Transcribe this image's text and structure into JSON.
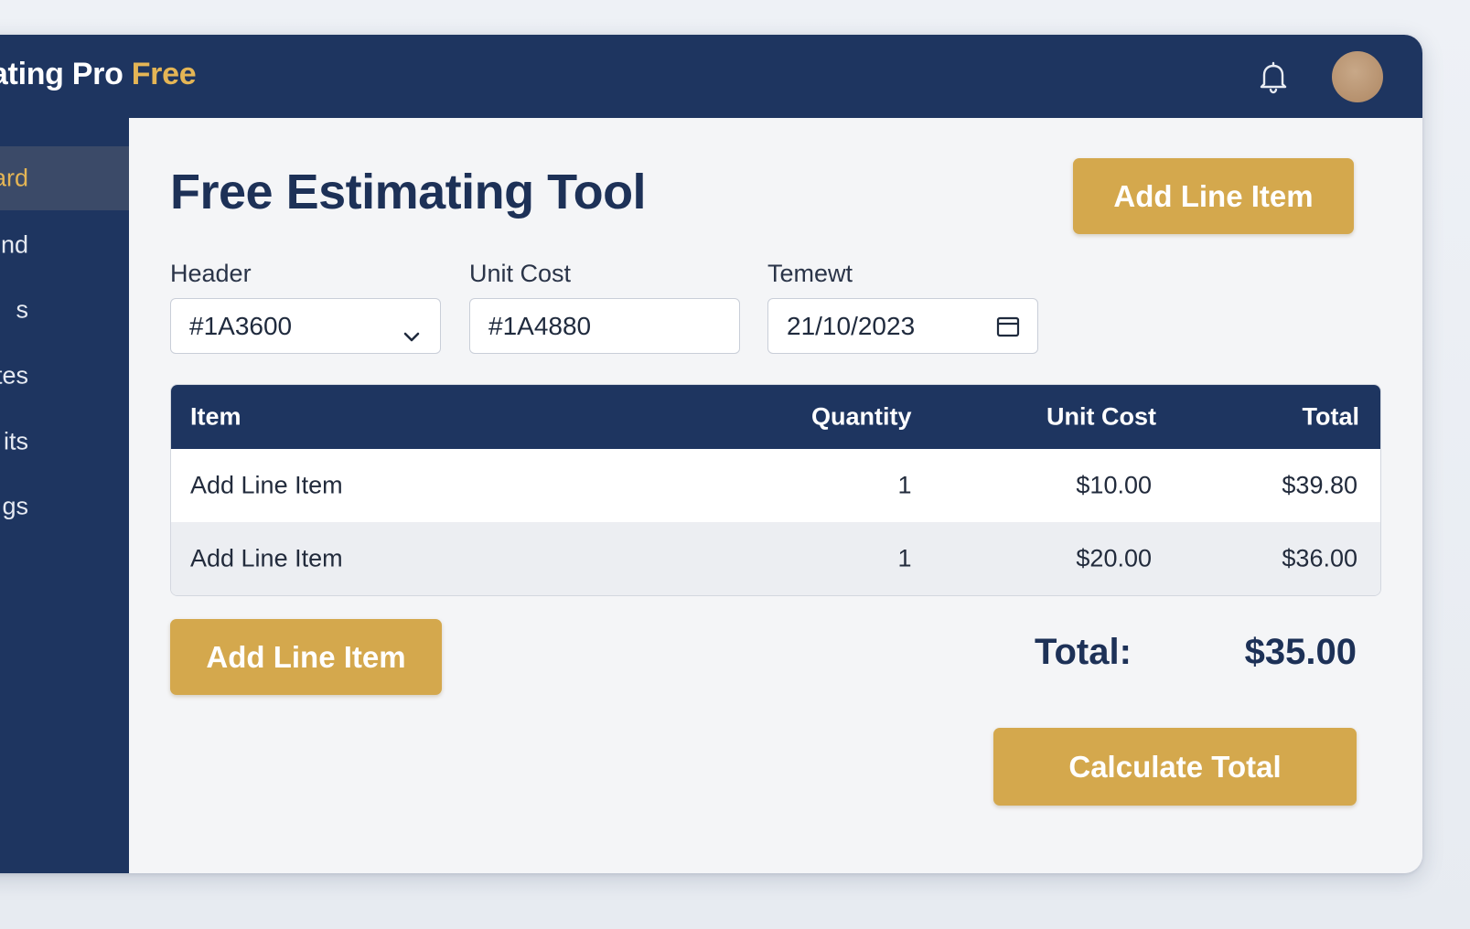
{
  "app": {
    "title_main": "mating Pro ",
    "title_accent": "Free"
  },
  "topbar": {
    "notification_icon": "bell-icon",
    "avatar_icon": "avatar"
  },
  "sidebar": {
    "items": [
      {
        "label": "oard",
        "active": true
      },
      {
        "label": "round",
        "active": false
      },
      {
        "label": "s",
        "active": false
      },
      {
        "label": "ates",
        "active": false
      },
      {
        "label": "its",
        "active": false
      },
      {
        "label": "gs",
        "active": false
      }
    ]
  },
  "main": {
    "page_title": "Free Estimating Tool",
    "add_line_item_top": "Add Line Item",
    "add_line_item_bottom": "Add Line Item",
    "calculate_total": "Calculate Total",
    "fields": {
      "header": {
        "label": "Header",
        "value": "#1A3600"
      },
      "unit_cost": {
        "label": "Unit Cost",
        "value": "#1A4880"
      },
      "date": {
        "label": "Temewt",
        "value": "21/10/2023"
      }
    },
    "table": {
      "columns": [
        "Item",
        "Quantity",
        "Unit Cost",
        "Total"
      ],
      "rows": [
        [
          "Add Line Item",
          "1",
          "$10.00",
          "$39.80"
        ],
        [
          "Add Line Item",
          "1",
          "$20.00",
          "$36.00"
        ]
      ]
    },
    "total": {
      "label": "Total:",
      "value": "$35.00"
    }
  },
  "colors": {
    "navy": "#1e3560",
    "gold": "#d4a84d",
    "gold_text": "#e4b555",
    "title_navy": "#1d3157"
  }
}
